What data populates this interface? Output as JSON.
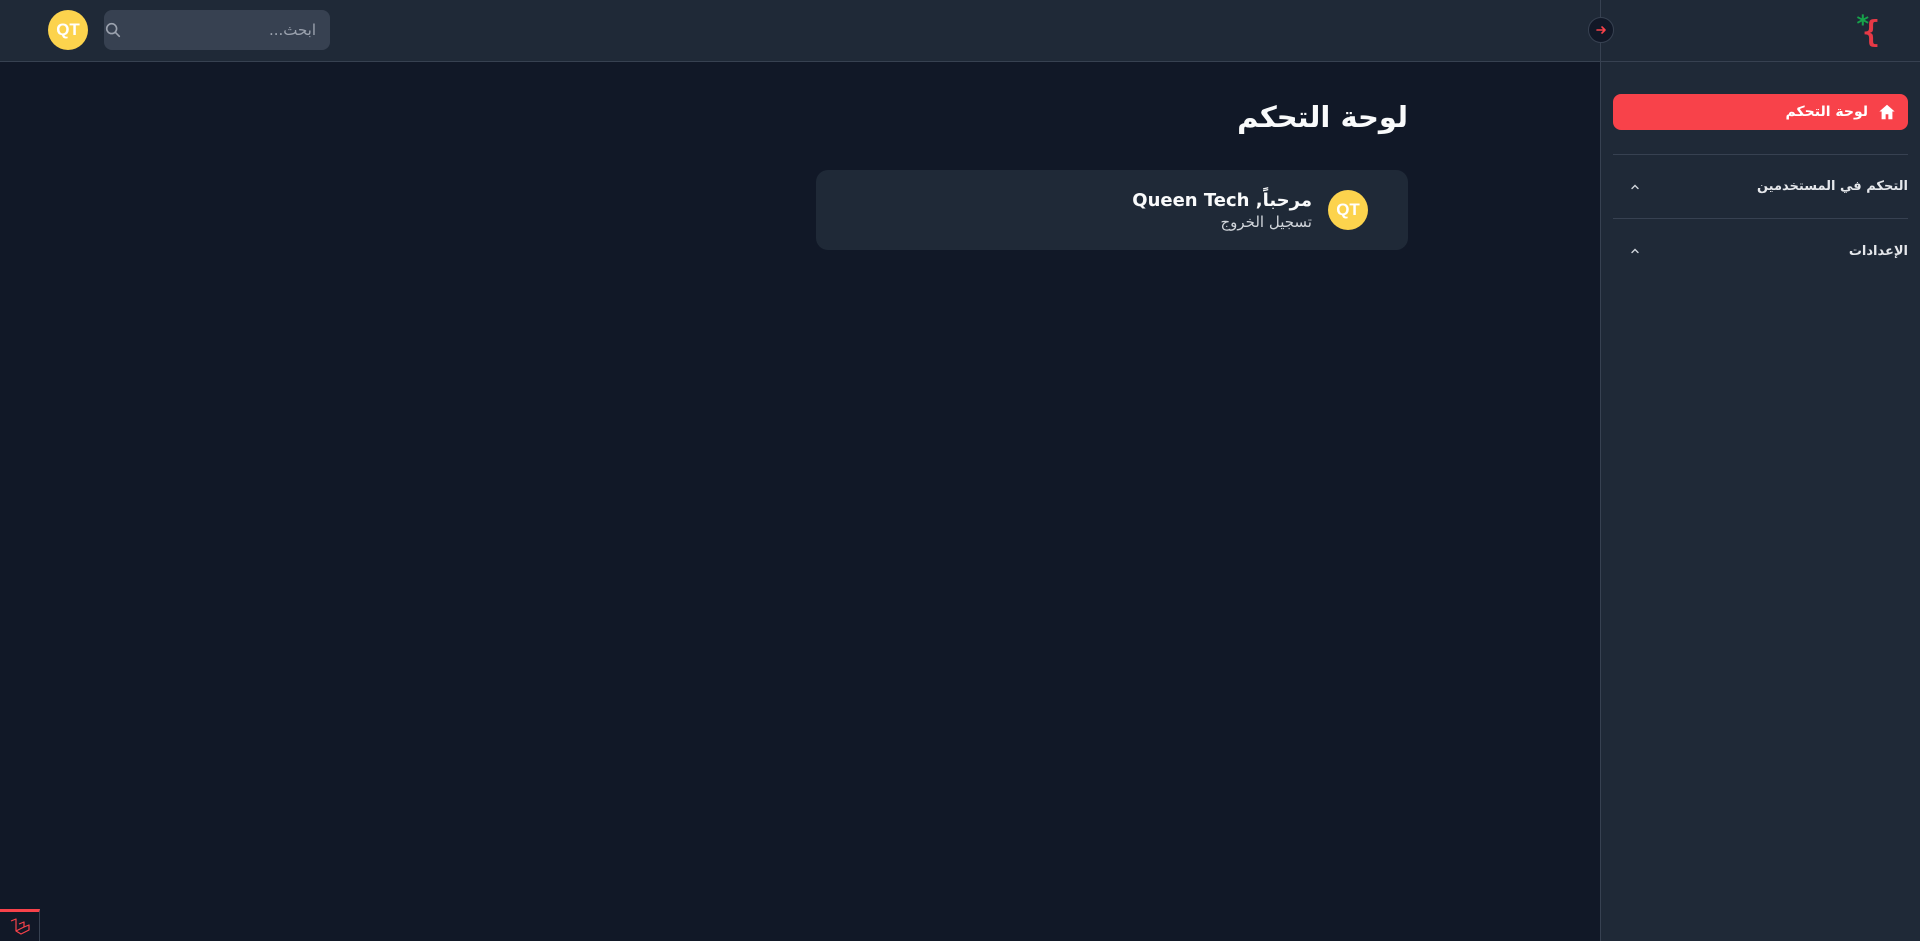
{
  "topbar": {
    "avatar_initials": "QT",
    "search_placeholder": "ابحث..."
  },
  "sidebar": {
    "active_item": {
      "label": "لوحة التحكم",
      "icon": "home-icon"
    },
    "groups": [
      {
        "label": "التحكم في المستخدمين",
        "icon": "chevron-up-icon"
      },
      {
        "label": "الإعدادات",
        "icon": "chevron-up-icon"
      }
    ]
  },
  "main": {
    "page_title": "لوحة التحكم",
    "welcome": {
      "avatar_initials": "QT",
      "greeting": "مرحباً, Queen Tech",
      "logout_label": "تسجيل الخروج"
    }
  },
  "colors": {
    "background": "#111827",
    "surface": "#1f2937",
    "accent": "#f8424a",
    "avatar": "#fcd34d",
    "logo_red": "#e63946",
    "logo_green": "#16a34a"
  }
}
